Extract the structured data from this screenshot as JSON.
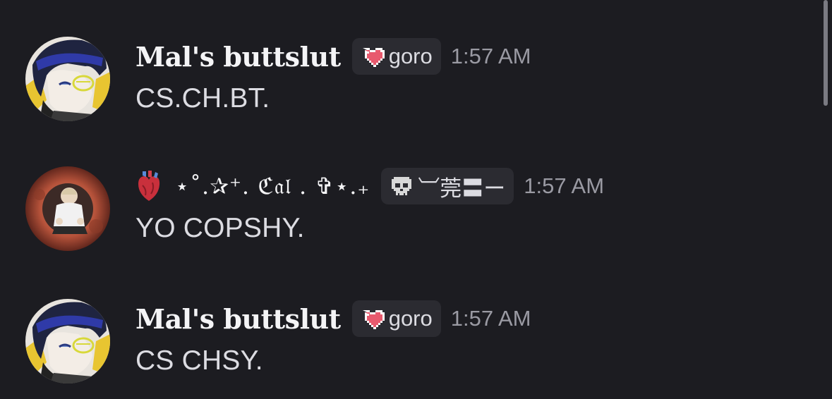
{
  "messages": [
    {
      "username": "Mal's buttslut",
      "tag_icon": "pixel-heart-icon",
      "tag_label": "goro",
      "timestamp": "1:57 AM",
      "text": "CS.CH.BT."
    },
    {
      "username_prefix_icon": "anatomical-heart-icon",
      "username": "⋆˚.✰⁺. ℭ𝔞𝔩 . ✞⋆.₊",
      "tag_icon": "skull-icon",
      "tag_label": "︺莞〓ー",
      "timestamp": "1:57 AM",
      "text": "YO COPSHY."
    },
    {
      "username": "Mal's buttslut",
      "tag_icon": "pixel-heart-icon",
      "tag_label": "goro",
      "timestamp": "1:57 AM",
      "text": "CS CHSY."
    }
  ],
  "colors": {
    "background": "#1c1c21",
    "tag_background": "#2b2b31",
    "username": "#f4f4f6",
    "timestamp": "#9a9aa3",
    "message_text": "#dcdce2"
  }
}
